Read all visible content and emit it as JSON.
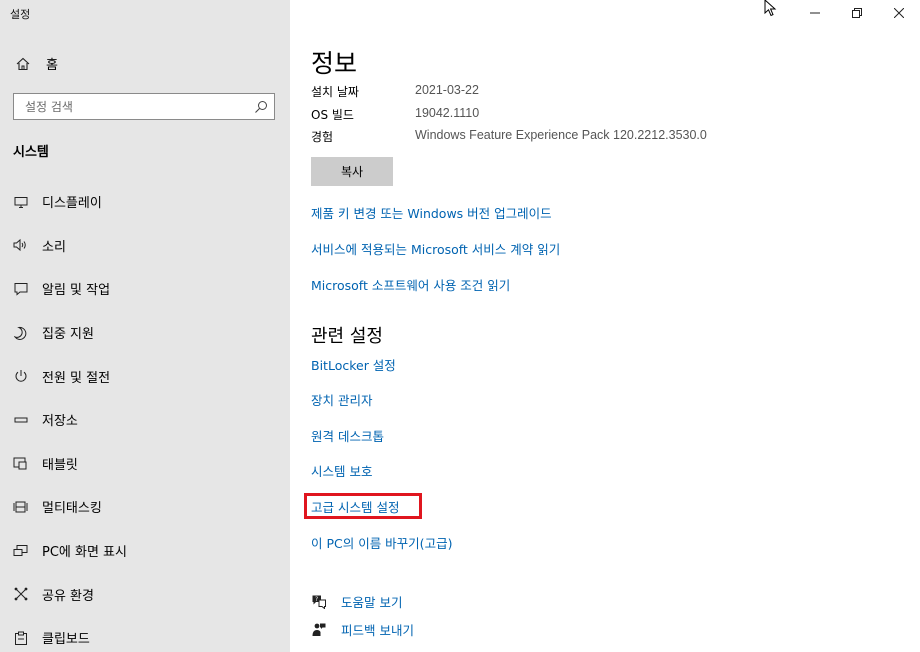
{
  "app": {
    "title": "설정"
  },
  "sidebar": {
    "home_label": "홈",
    "search_placeholder": "설정 검색",
    "section_title": "시스템",
    "items": [
      {
        "label": "디스플레이",
        "icon": "monitor-icon"
      },
      {
        "label": "소리",
        "icon": "speaker-icon"
      },
      {
        "label": "알림 및 작업",
        "icon": "notification-icon"
      },
      {
        "label": "집중 지원",
        "icon": "moon-icon"
      },
      {
        "label": "전원 및 절전",
        "icon": "power-icon"
      },
      {
        "label": "저장소",
        "icon": "storage-icon"
      },
      {
        "label": "태블릿",
        "icon": "tablet-icon"
      },
      {
        "label": "멀티태스킹",
        "icon": "multitasking-icon"
      },
      {
        "label": "PC에 화면 표시",
        "icon": "project-icon"
      },
      {
        "label": "공유 환경",
        "icon": "share-icon"
      },
      {
        "label": "클립보드",
        "icon": "clipboard-icon"
      }
    ]
  },
  "main": {
    "title": "정보",
    "info": [
      {
        "key": "설치 날짜",
        "value": "2021-03-22"
      },
      {
        "key": "OS 빌드",
        "value": "19042.1110"
      },
      {
        "key": "경험",
        "value": "Windows Feature Experience Pack 120.2212.3530.0"
      }
    ],
    "copy_label": "복사",
    "links": [
      "제품 키 변경 또는 Windows 버전 업그레이드",
      "서비스에 적용되는 Microsoft 서비스 계약 읽기",
      "Microsoft 소프트웨어 사용 조건 읽기"
    ],
    "related_title": "관련 설정",
    "related_links": [
      "BitLocker 설정",
      "장치 관리자",
      "원격 데스크톱",
      "시스템 보호",
      "고급 시스템 설정",
      "이 PC의 이름 바꾸기(고급)"
    ],
    "help_links": [
      {
        "label": "도움말 보기",
        "icon": "help-icon"
      },
      {
        "label": "피드백 보내기",
        "icon": "feedback-icon"
      }
    ],
    "highlight_color": "#e0161f",
    "link_color": "#0063b1"
  }
}
